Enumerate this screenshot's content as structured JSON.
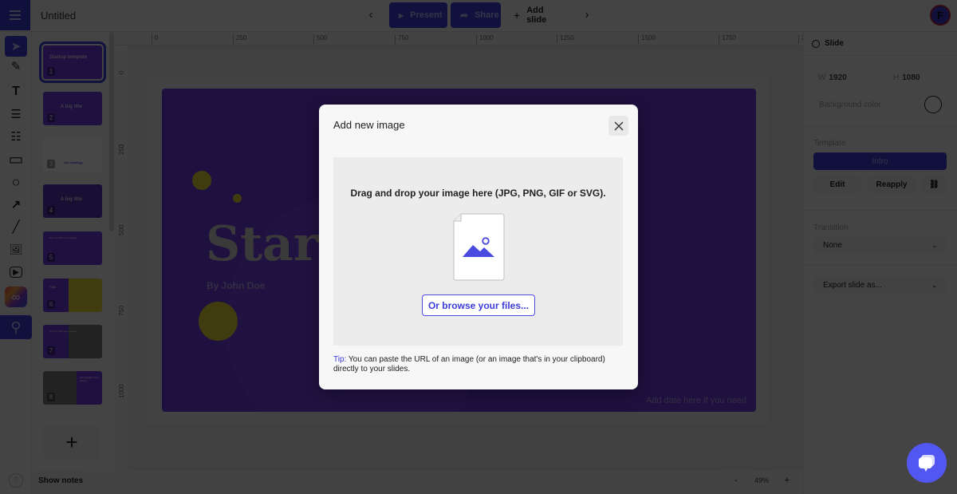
{
  "app": {
    "doc_title": "Untitled",
    "menu_icon": "hamburger-icon",
    "avatar_initial": "F"
  },
  "topbar": {
    "prev_label": "‹",
    "next_label": "›",
    "present_label": "Present",
    "share_label": "Share",
    "add_slide_label": "Add slide"
  },
  "toolbar": {
    "tools": [
      {
        "name": "select-tool",
        "glyph": "➤"
      },
      {
        "name": "pen-tool",
        "glyph": "✎"
      },
      {
        "name": "text-tool",
        "glyph": "T"
      },
      {
        "name": "paragraph-tool",
        "glyph": "☰"
      },
      {
        "name": "list-tool",
        "glyph": "☷"
      },
      {
        "name": "rectangle-tool",
        "glyph": "▭"
      },
      {
        "name": "circle-tool",
        "glyph": "○"
      },
      {
        "name": "arrow-tool",
        "glyph": "↗"
      },
      {
        "name": "line-tool",
        "glyph": "╱"
      },
      {
        "name": "image-tool",
        "glyph": "🖼"
      },
      {
        "name": "video-tool",
        "glyph": "▶"
      },
      {
        "name": "creative-cloud-tool",
        "glyph": "∞"
      },
      {
        "name": "search-tool",
        "glyph": "⚲"
      }
    ],
    "help_label": "?"
  },
  "slides": {
    "items": [
      {
        "number": "1",
        "title": "Startup template"
      },
      {
        "number": "2",
        "title": "A big title"
      },
      {
        "number": "3",
        "title": "Our strategy"
      },
      {
        "number": "4",
        "title": "A big title"
      },
      {
        "number": "5",
        "title": "Our big title here please"
      },
      {
        "number": "6",
        "title": "Title"
      },
      {
        "number": "7",
        "title": "Our big title here please"
      },
      {
        "number": "8",
        "title": "Our big title here please"
      }
    ],
    "add_label": "+",
    "show_notes_label": "Show notes"
  },
  "rulers": {
    "horizontal": [
      "0",
      "250",
      "500",
      "750",
      "1000",
      "1250",
      "1500",
      "1750",
      "2"
    ],
    "vertical": [
      "0",
      "250",
      "500",
      "750",
      "1000"
    ]
  },
  "slide": {
    "title": "Startup template",
    "visible_title": "Start",
    "author": "By John Doe",
    "date_placeholder": "Add date here if you need"
  },
  "zoom": {
    "minus": "-",
    "value": "49%",
    "plus": "+"
  },
  "right_panel": {
    "header": "Slide",
    "width_label": "W",
    "width_value": "1920",
    "height_label": "H",
    "height_value": "1080",
    "background_color_label": "Background color",
    "template_label": "Template",
    "template_value": "Intro",
    "edit_label": "Edit",
    "reapply_label": "Reapply",
    "transition_label": "Transition",
    "transition_value": "None",
    "export_label": "Export slide as..."
  },
  "modal": {
    "title": "Add new image",
    "drop_text": "Drag and drop your image here (JPG, PNG, GIF or SVG).",
    "browse_label": "Or browse your files...",
    "tip_label": "Tip:",
    "tip_text": " You can paste the URL of an image (or an image that's in your clipboard) directly to your slides."
  },
  "colors": {
    "accent": "#3d3dd9",
    "slide_purple": "#6c3be0",
    "slide_yellow": "#e8d83a",
    "chat_button": "#5157f0",
    "link_blue": "#3c3cd8"
  }
}
